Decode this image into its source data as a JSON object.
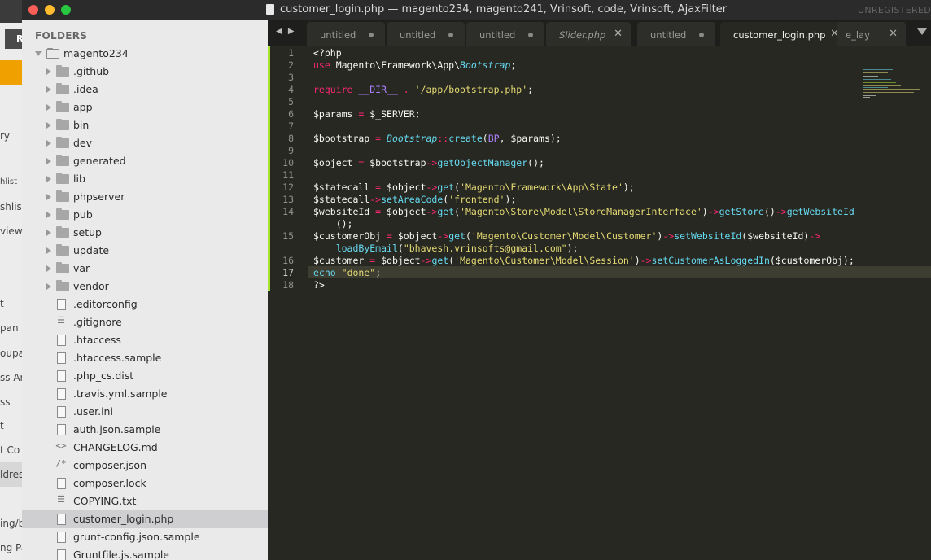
{
  "window": {
    "title": "customer_login.php — magento234, magento241, Vrinsoft, code, Vrinsoft, AjaxFilter",
    "registration": "UNREGISTERED"
  },
  "background_app": {
    "button_label": "R",
    "fragments": [
      "ry",
      "hlist",
      "shlis",
      "view",
      "t",
      "pan",
      "oupa",
      "ss Ar",
      "ss",
      "t",
      "t Co",
      "ldres",
      "ing/b",
      "ng Pa"
    ]
  },
  "sidebar": {
    "header": "FOLDERS",
    "root": "magento234",
    "folders": [
      ".github",
      ".idea",
      "app",
      "bin",
      "dev",
      "generated",
      "lib",
      "phpserver",
      "pub",
      "setup",
      "update",
      "var",
      "vendor"
    ],
    "files": [
      {
        "name": ".editorconfig",
        "icon": "file-icon"
      },
      {
        "name": ".gitignore",
        "icon": "lines-file-icon"
      },
      {
        "name": ".htaccess",
        "icon": "file-icon"
      },
      {
        "name": ".htaccess.sample",
        "icon": "file-icon"
      },
      {
        "name": ".php_cs.dist",
        "icon": "file-icon"
      },
      {
        "name": ".travis.yml.sample",
        "icon": "file-icon"
      },
      {
        "name": ".user.ini",
        "icon": "file-icon"
      },
      {
        "name": "auth.json.sample",
        "icon": "file-icon"
      },
      {
        "name": "CHANGELOG.md",
        "icon": "code-file-icon"
      },
      {
        "name": "composer.json",
        "icon": "comment-file-icon"
      },
      {
        "name": "composer.lock",
        "icon": "file-icon"
      },
      {
        "name": "COPYING.txt",
        "icon": "lines-file-icon"
      },
      {
        "name": "customer_login.php",
        "icon": "file-icon"
      },
      {
        "name": "grunt-config.json.sample",
        "icon": "file-icon"
      },
      {
        "name": "Gruntfile.js.sample",
        "icon": "file-icon"
      }
    ],
    "selected": "customer_login.php"
  },
  "tabs": [
    {
      "label": "untitled",
      "state": "modified"
    },
    {
      "label": "untitled",
      "state": "modified"
    },
    {
      "label": "untitled",
      "state": "modified"
    },
    {
      "label": "Slider.php",
      "state": "closable"
    },
    {
      "label": "untitled",
      "state": "modified"
    },
    {
      "label": "customer_login.php",
      "state": "active"
    },
    {
      "label": "e_lay",
      "state": "closable"
    }
  ],
  "nav_arrows": "◀ ▶",
  "editor": {
    "line_numbers": [
      "1",
      "2",
      "3",
      "4",
      "5",
      "6",
      "7",
      "8",
      "9",
      "10",
      "11",
      "12",
      "13",
      "14",
      "",
      "15",
      "",
      "16",
      "17",
      "18"
    ],
    "current_line": "17",
    "lines": {
      "l1": "<?php",
      "l2_use": "use",
      "l2_ns": " Magento\\Framework\\App\\",
      "l2_cls": "Bootstrap",
      "l2_end": ";",
      "l4_req": "require",
      "l4_sp": " ",
      "l4_dir": "__DIR__",
      "l4_dot": " . ",
      "l4_str": "'/app/bootstrap.php'",
      "l4_end": ";",
      "l6_a": "$params ",
      "l6_op": "=",
      "l6_b": " $_SERVER;",
      "l8_a": "$bootstrap ",
      "l8_op": "=",
      "l8_sp": " ",
      "l8_cls": "Bootstrap",
      "l8_sc": "::",
      "l8_fn": "create",
      "l8_p": "(",
      "l8_c": "BP",
      "l8_rest": ", $params);",
      "l10_a": "$object ",
      "l10_op": "=",
      "l10_b": " $bootstrap",
      "l10_arr": "->",
      "l10_fn": "getObjectManager",
      "l10_end": "();",
      "l12_a": "$statecall ",
      "l12_op": "=",
      "l12_b": " $object",
      "l12_arr": "->",
      "l12_fn": "get",
      "l12_p": "(",
      "l12_s": "'Magento\\Framework\\App\\State'",
      "l12_end": ");",
      "l13_a": "$statecall",
      "l13_arr": "->",
      "l13_fn": "setAreaCode",
      "l13_p": "(",
      "l13_s": "'frontend'",
      "l13_end": ");",
      "l14_a": "$websiteId ",
      "l14_op": "=",
      "l14_b": " $object",
      "l14_arr": "->",
      "l14_fn": "get",
      "l14_p": "(",
      "l14_s": "'Magento\\Store\\Model\\StoreManagerInterface'",
      "l14_cl": ")",
      "l14_arr2": "->",
      "l14_fn2": "getStore",
      "l14_pp": "()",
      "l14_arr3": "->",
      "l14_fn3": "getWebsiteId",
      "l14_wrap": "    ();",
      "l15_a": "$customerObj ",
      "l15_op": "=",
      "l15_b": " $object",
      "l15_arr": "->",
      "l15_fn": "get",
      "l15_p": "(",
      "l15_s": "'Magento\\Customer\\Model\\Customer'",
      "l15_cl": ")",
      "l15_arr2": "->",
      "l15_fn2": "setWebsiteId",
      "l15_rest": "($websiteId)",
      "l15_arr3": "->",
      "l15_ind": "    ",
      "l15_fn3": "loadByEmail",
      "l15_p2": "(",
      "l15_s2": "\"bhavesh.vrinsofts@gmail.com\"",
      "l15_end": ");",
      "l16_a": "$customer ",
      "l16_op": "=",
      "l16_b": " $object",
      "l16_arr": "->",
      "l16_fn": "get",
      "l16_p": "(",
      "l16_s": "'Magento\\Customer\\Model\\Session'",
      "l16_cl": ")",
      "l16_arr2": "->",
      "l16_fn2": "setCustomerAsLoggedIn",
      "l16_rest": "($customerObj);",
      "l17_kw": "echo",
      "l17_sp": " ",
      "l17_s": "\"done\"",
      "l17_end": ";",
      "l18": "?>"
    }
  },
  "colors": {
    "editor_bg": "#272822",
    "keyword": "#f92672",
    "function": "#66d9ef",
    "string": "#e6db74",
    "constant": "#ae81ff",
    "modified_bar": "#a6e22e",
    "sidebar_bg": "#eaeaea",
    "selection": "#cfcfd2"
  }
}
